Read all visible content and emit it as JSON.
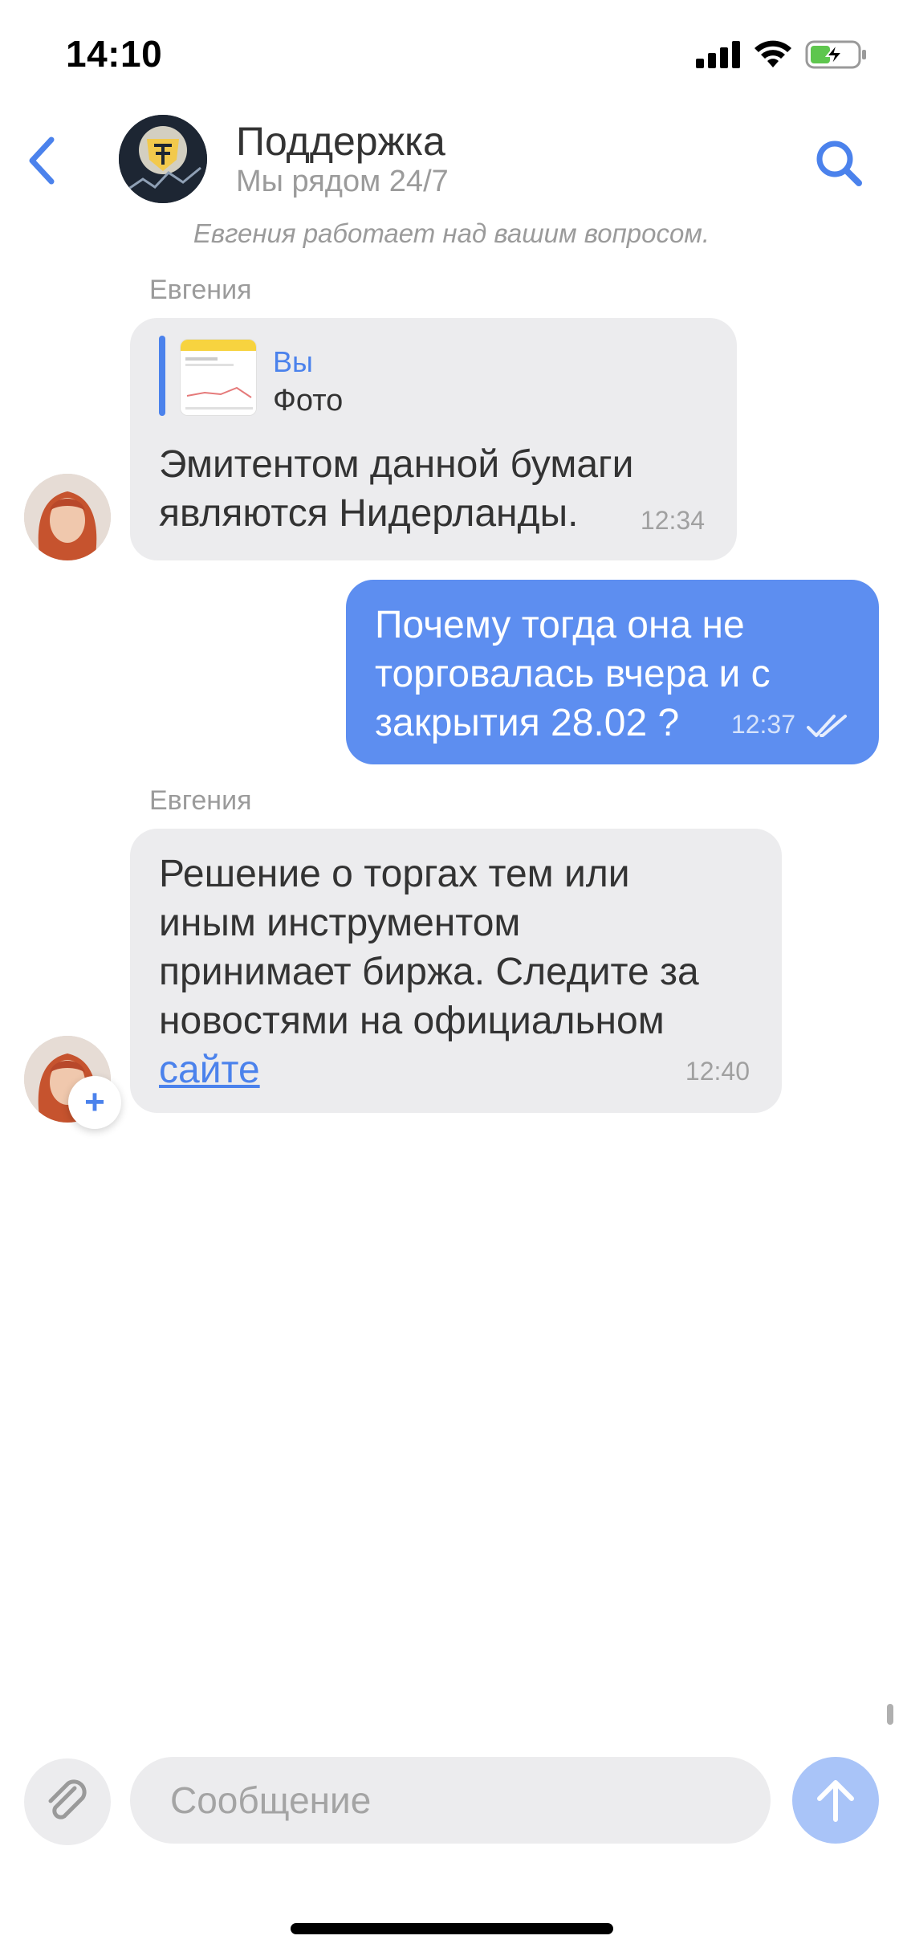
{
  "status_bar": {
    "time": "14:10"
  },
  "header": {
    "title": "Поддержка",
    "subtitle": "Мы рядом 24/7"
  },
  "notice": "Евгения работает над вашим вопросом.",
  "messages": [
    {
      "direction": "incoming",
      "sender": "Евгения",
      "reply": {
        "author": "Вы",
        "label": "Фото"
      },
      "lines": [
        "Эмитентом данной бумаги",
        "являются Нидерланды."
      ],
      "time": "12:34"
    },
    {
      "direction": "outgoing",
      "lines": [
        "Почему тогда она не",
        "торговалась вчера и с",
        "закрытия 28.02 ?"
      ],
      "time": "12:37",
      "status_icon": "double-check-icon"
    },
    {
      "direction": "incoming",
      "sender": "Евгения",
      "lines": [
        "Решение о торгах тем или",
        "иным инструментом",
        "принимает биржа. Следите за",
        "новостями на официальном"
      ],
      "link_text": "сайте",
      "time": "12:40"
    }
  ],
  "composer": {
    "placeholder": "Сообщение"
  },
  "colors": {
    "accent": "#4b82ec",
    "outgoing_bubble": "#5d8ef0",
    "incoming_bubble": "#ececee",
    "battery": "#5ec64e"
  },
  "icons": {
    "back": "chevron-left-icon",
    "search": "search-icon",
    "attach": "paperclip-icon",
    "send": "arrow-up-icon",
    "add": "plus-icon"
  }
}
